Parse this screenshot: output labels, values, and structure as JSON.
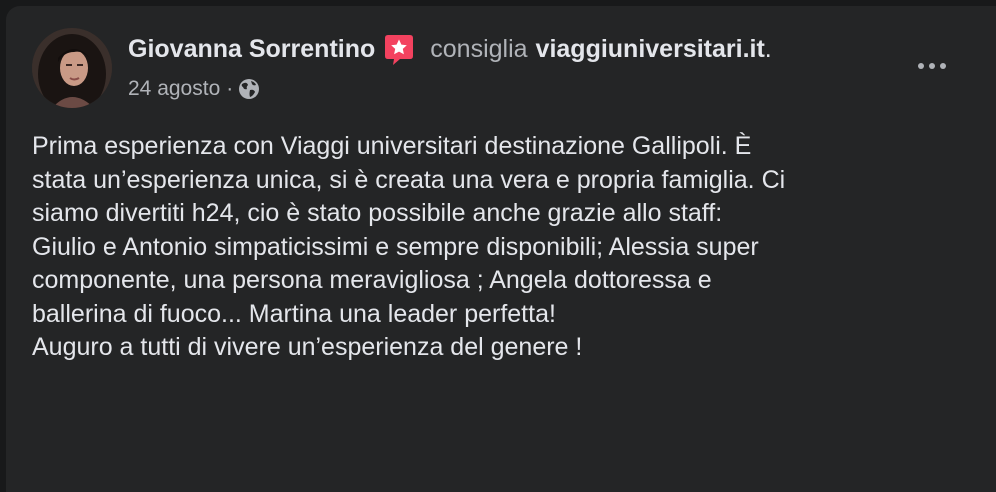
{
  "post": {
    "author_name": "Giovanna Sorrentino",
    "action_verb": "consiglia",
    "page_name": "viaggiuniversitari.it",
    "period": ".",
    "date": "24 agosto",
    "separator": "·",
    "privacy_icon": "globe-icon",
    "recommend_icon": "recommend-star-icon",
    "more_icon": "more-options-icon",
    "body_lines": [
      "Prima esperienza con Viaggi universitari destinazione Gallipoli. È",
      "stata un’esperienza unica, si è creata una vera e propria famiglia. Ci",
      "siamo divertiti h24, cio è stato possibile anche grazie allo staff:",
      "Giulio e Antonio simpaticissimi e sempre disponibili; Alessia super",
      "componente, una persona meravigliosa ; Angela dottoressa e",
      "ballerina di fuoco... Martina una leader perfetta!",
      "Auguro a tutti di vivere un’esperienza del genere !"
    ]
  },
  "colors": {
    "background": "#18191a",
    "card": "#242526",
    "primary_text": "#e4e6eb",
    "secondary_text": "#b0b3b8",
    "recommend_badge": "#f3425f"
  }
}
